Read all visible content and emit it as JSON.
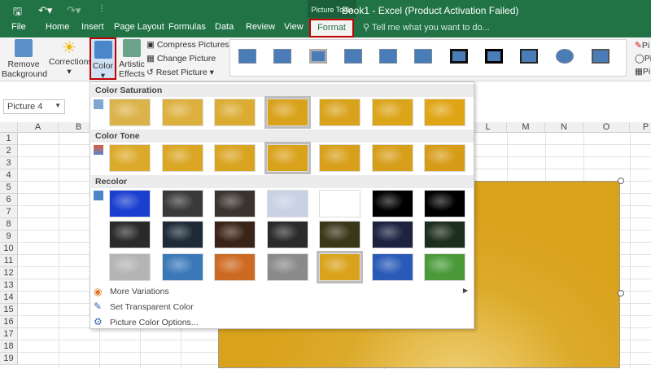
{
  "title_bar": {
    "title": "Book1 - Excel (Product Activation Failed)",
    "context_group": "Picture Tools",
    "tell_me": "Tell me what you want to do..."
  },
  "tabs": [
    "File",
    "Home",
    "Insert",
    "Page Layout",
    "Formulas",
    "Data",
    "Review",
    "View",
    "Format"
  ],
  "ribbon": {
    "remove_background": "Remove Background",
    "corrections": "Corrections",
    "color": "Color",
    "artistic_effects": "Artistic Effects",
    "compress": "Compress Pictures",
    "change": "Change Picture",
    "reset": "Reset Picture",
    "side": [
      "Pi",
      "Pi",
      "Pi"
    ]
  },
  "name_box": "Picture 4",
  "columns": [
    "A",
    "B",
    "L",
    "M",
    "N",
    "O",
    "P"
  ],
  "rows": [
    "1",
    "2",
    "3",
    "4",
    "5",
    "6",
    "7",
    "8",
    "9",
    "10",
    "11",
    "12",
    "13",
    "14",
    "15",
    "16",
    "17",
    "18",
    "19"
  ],
  "color_menu": {
    "sections": [
      "Color Saturation",
      "Color Tone",
      "Recolor"
    ],
    "saturation_colors": [
      "#dcb34a",
      "#ddb03e",
      "#dcac32",
      "#d9a21b",
      "#d9a21b",
      "#dca418",
      "#dfa514"
    ],
    "tone_colors": [
      "#dcaa2a",
      "#daa624",
      "#d9a420",
      "#d9a21b",
      "#d8a01a",
      "#d79e1a",
      "#d69c18"
    ],
    "recolor_rows": [
      [
        "#1a3fd0",
        "#3a3a3a",
        "#3a342e",
        "#c8d2e4",
        "#ffffff",
        "#000000",
        "#000000"
      ],
      [
        "#2a2a2a",
        "#1e2a38",
        "#3a2418",
        "#2a2a2a",
        "#3a3618",
        "#1c2240",
        "#1e2e1e"
      ],
      [
        "#b4b4b4",
        "#3a78b8",
        "#cc6a22",
        "#8a8a8a",
        "#d9a21b",
        "#2a5ab8",
        "#4a9a3a"
      ]
    ],
    "items": [
      "More Variations",
      "Set Transparent Color",
      "Picture Color Options..."
    ]
  }
}
